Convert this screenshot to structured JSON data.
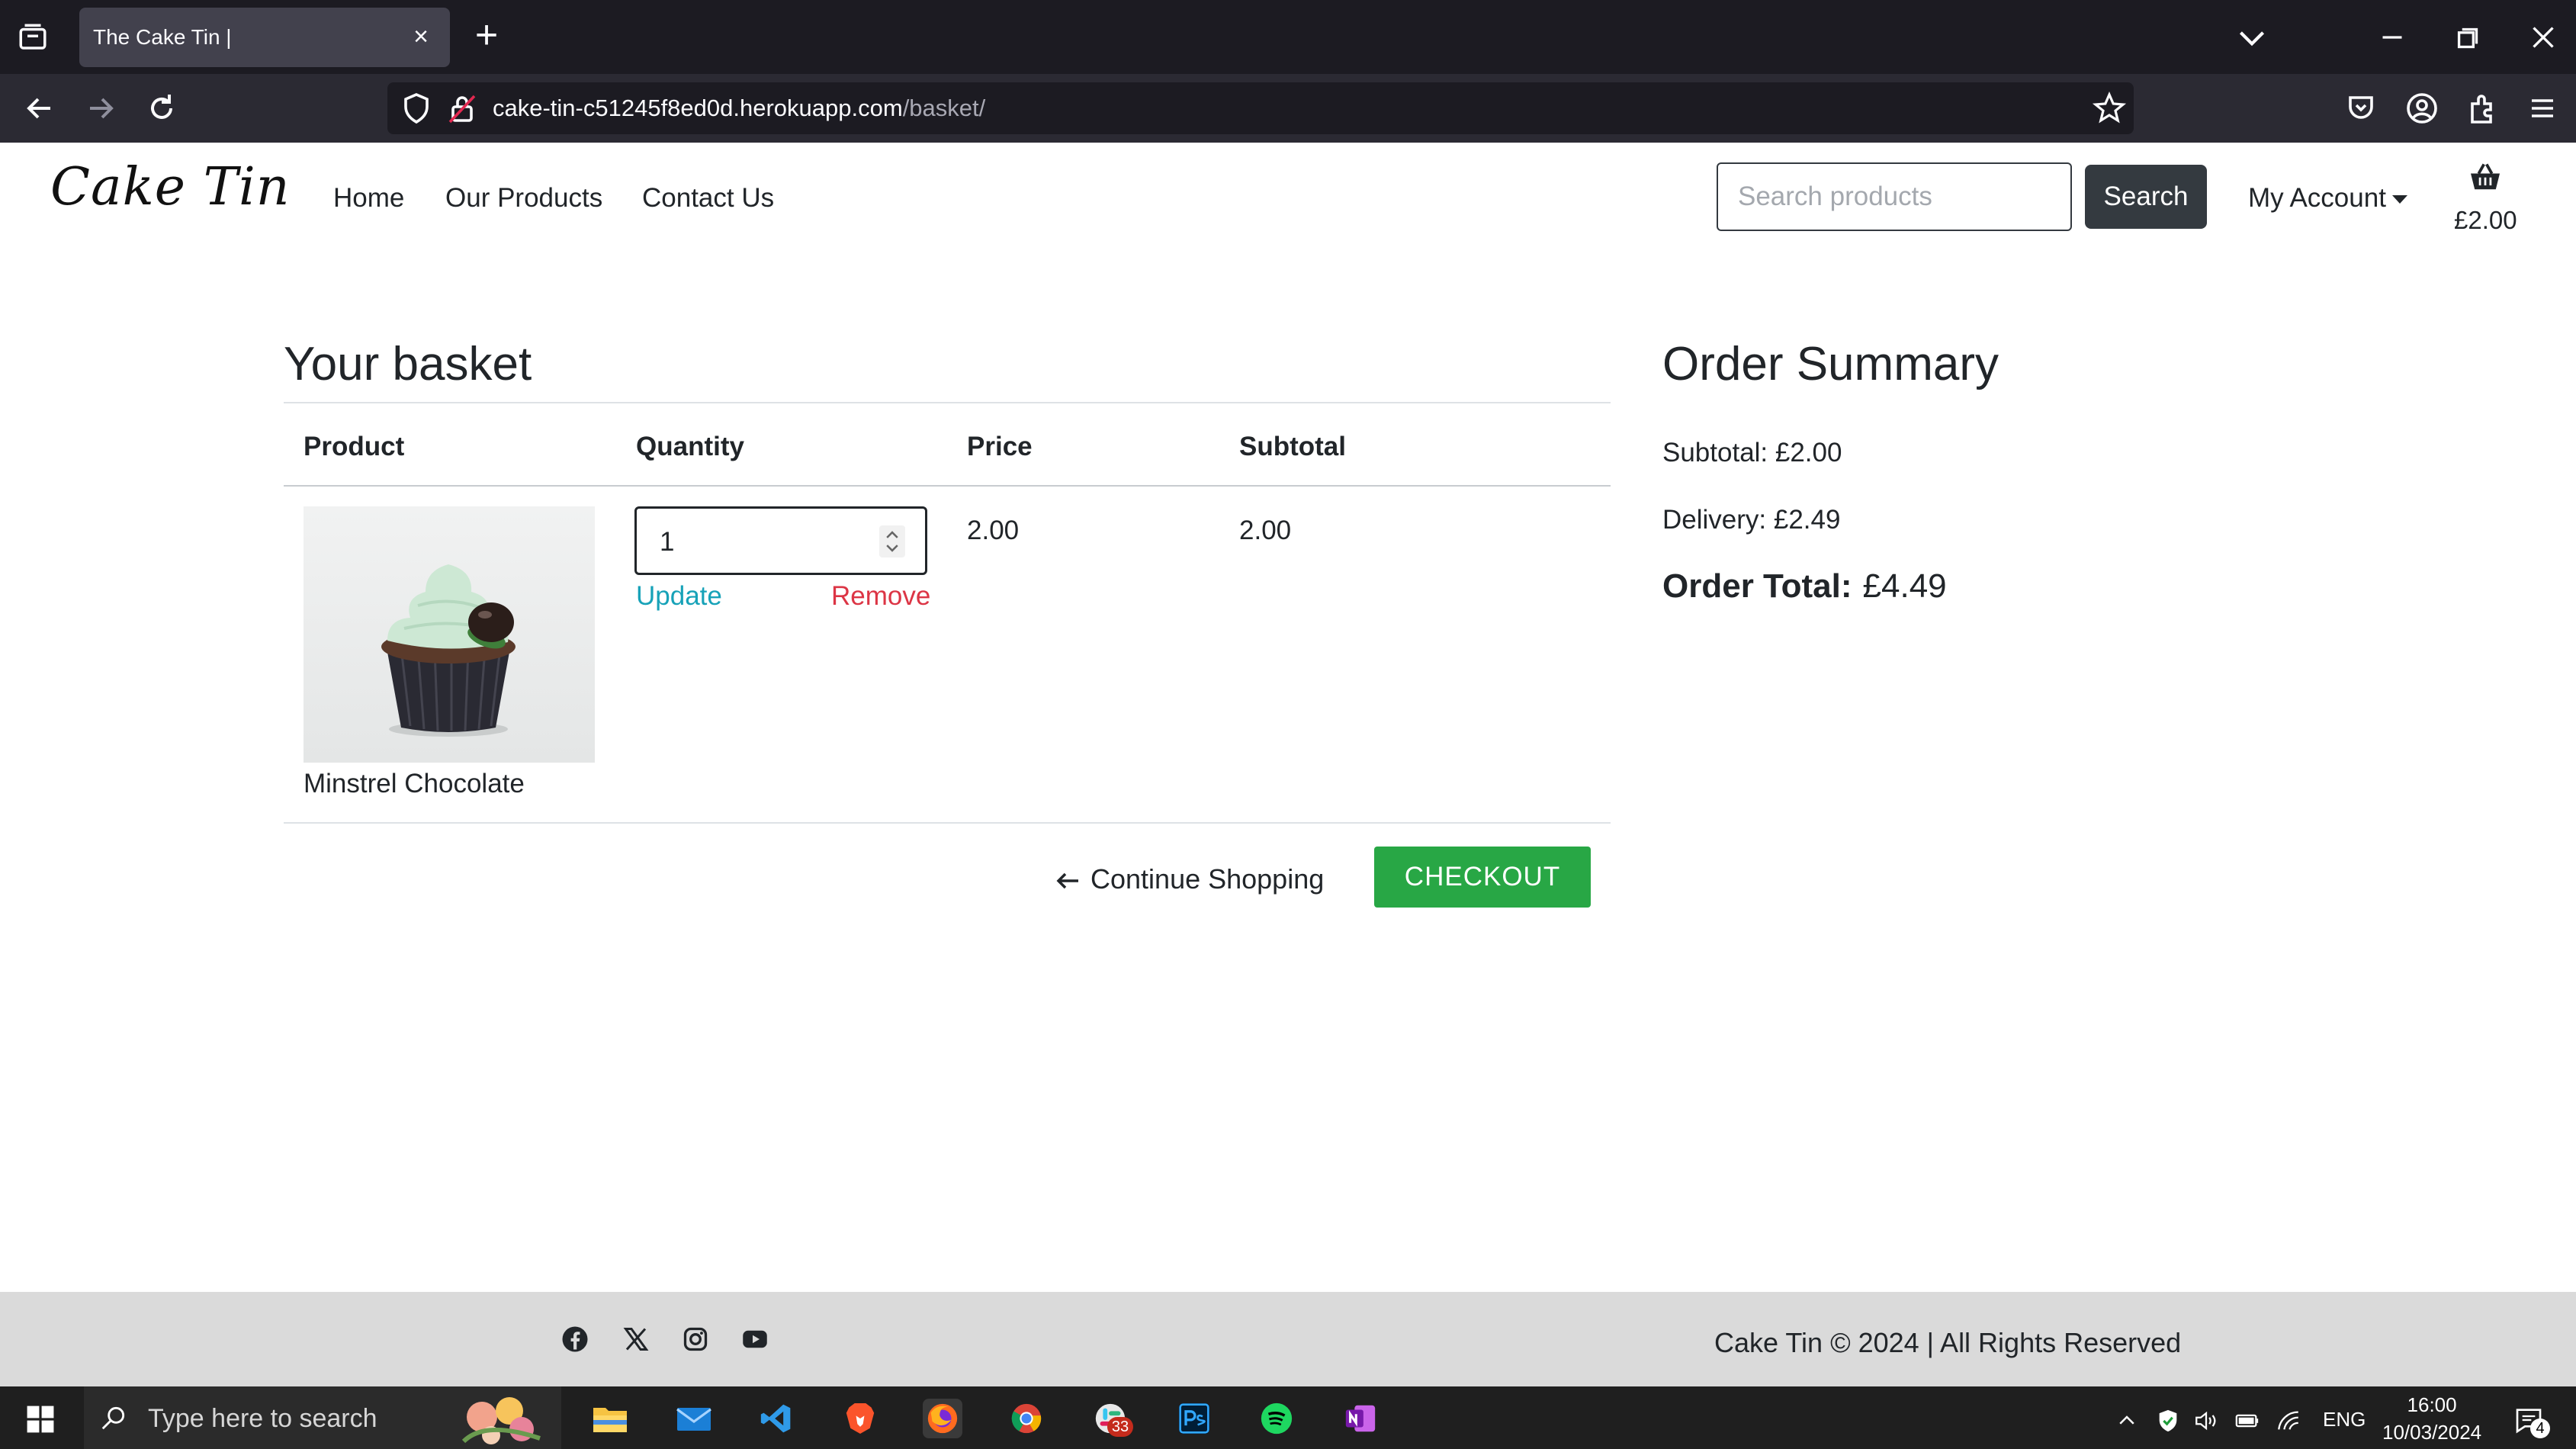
{
  "browser": {
    "tab_title": "The Cake Tin |",
    "url_host": "cake-tin-c51245f8ed0d.herokuapp.com",
    "url_path": "/basket/"
  },
  "site": {
    "logo": "Cake Tin",
    "nav": [
      "Home",
      "Our Products",
      "Contact Us"
    ],
    "search_placeholder": "Search products",
    "search_button": "Search",
    "account": "My Account",
    "basket_total": "£2.00"
  },
  "basket": {
    "title": "Your basket",
    "headers": [
      "Product",
      "Quantity",
      "Price",
      "Subtotal"
    ],
    "items": [
      {
        "name": "Minstrel Chocolate",
        "quantity": "1",
        "price": "2.00",
        "subtotal": "2.00",
        "update_label": "Update",
        "remove_label": "Remove"
      }
    ],
    "continue_label": "Continue Shopping",
    "checkout_label": "CHECKOUT"
  },
  "summary": {
    "title": "Order Summary",
    "subtotal": "Subtotal: £2.00",
    "delivery": "Delivery: £2.49",
    "total_label": "Order Total:",
    "total_value": "£4.49"
  },
  "footer": {
    "social_icons": [
      "facebook-icon",
      "x-icon",
      "instagram-icon",
      "youtube-icon"
    ],
    "copyright": "Cake Tin © 2024 | All Rights Reserved"
  },
  "taskbar": {
    "search_placeholder": "Type here to search",
    "slack_badge": "33",
    "language": "ENG",
    "time": "16:00",
    "date": "10/03/2024",
    "notification_count": "4"
  },
  "colors": {
    "checkout": "#28a745",
    "update": "#17a2b8",
    "remove": "#dc3545",
    "dark_button": "#343a40",
    "footer": "#dadada"
  }
}
